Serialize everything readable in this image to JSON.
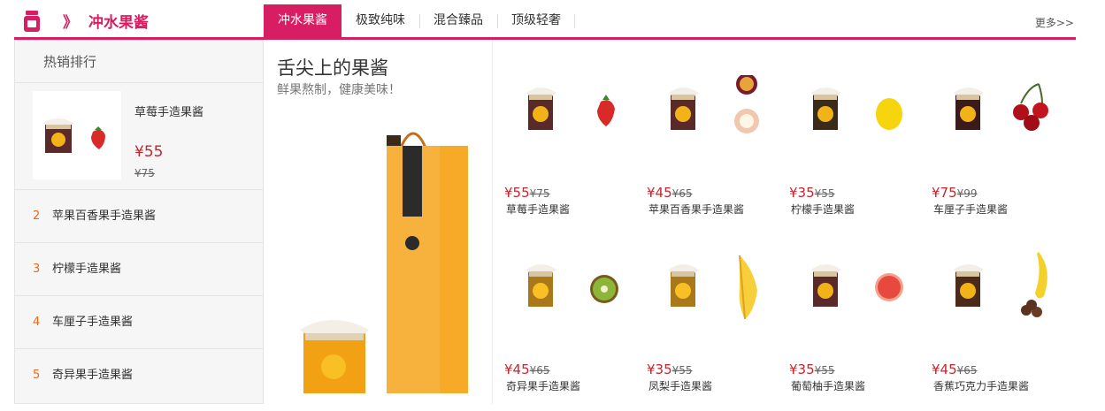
{
  "header": {
    "icon": "jar-icon",
    "arrows": "》",
    "title": "冲水果酱",
    "tabs": [
      {
        "label": "冲水果酱",
        "active": true
      },
      {
        "label": "极致纯味",
        "active": false
      },
      {
        "label": "混合臻品",
        "active": false
      },
      {
        "label": "顶级轻奢",
        "active": false
      }
    ],
    "more": "更多>>",
    "accent": "#d81e62"
  },
  "ranking": {
    "title": "热销排行",
    "top": {
      "name": "草莓手造果酱",
      "price": "¥55",
      "old_price": "¥75"
    },
    "items": [
      {
        "num": "2",
        "name": "苹果百香果手造果酱"
      },
      {
        "num": "3",
        "name": "柠檬手造果酱"
      },
      {
        "num": "4",
        "name": "车厘子手造果酱"
      },
      {
        "num": "5",
        "name": "奇异果手造果酱"
      }
    ]
  },
  "feature": {
    "title": "舌尖上的果酱",
    "subtitle": "鲜果熬制，健康美味！"
  },
  "products": [
    {
      "price": "¥55",
      "old_price": "¥75",
      "name": "草莓手造果酱",
      "fruit": "strawberry"
    },
    {
      "price": "¥45",
      "old_price": "¥65",
      "name": "苹果百香果手造果酱",
      "fruit": "apple-passionfruit"
    },
    {
      "price": "¥35",
      "old_price": "¥55",
      "name": "柠檬手造果酱",
      "fruit": "lemon"
    },
    {
      "price": "¥75",
      "old_price": "¥99",
      "name": "车厘子手造果酱",
      "fruit": "cherry"
    },
    {
      "price": "¥45",
      "old_price": "¥65",
      "name": "奇异果手造果酱",
      "fruit": "kiwi"
    },
    {
      "price": "¥35",
      "old_price": "¥55",
      "name": "凤梨手造果酱",
      "fruit": "pineapple"
    },
    {
      "price": "¥35",
      "old_price": "¥55",
      "name": "葡萄柚手造果酱",
      "fruit": "grapefruit"
    },
    {
      "price": "¥45",
      "old_price": "¥65",
      "name": "香蕉巧克力手造果酱",
      "fruit": "banana-chocolate"
    }
  ]
}
